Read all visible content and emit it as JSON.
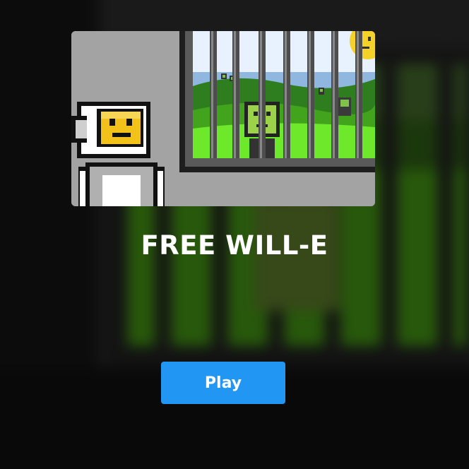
{
  "game": {
    "title": "FREE WILL-E",
    "play_label": "Play",
    "accent_color": "#2196f3",
    "thumbnail": {
      "scene": "cartoon robot beside a window with bars overlooking green hills",
      "icons": [
        "robot-character-icon",
        "barred-window-icon",
        "sun-icon"
      ]
    }
  }
}
